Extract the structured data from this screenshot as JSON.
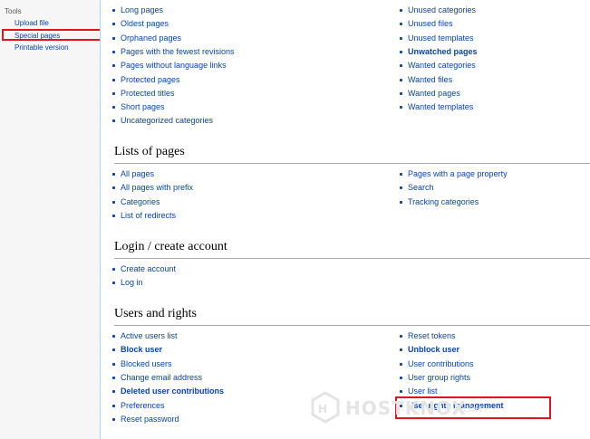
{
  "sidebar": {
    "heading": "Tools",
    "links": [
      "Upload file",
      "Special pages",
      "Printable version"
    ]
  },
  "top_lists": {
    "left": [
      {
        "label": "Long pages",
        "bold": false
      },
      {
        "label": "Oldest pages",
        "bold": false
      },
      {
        "label": "Orphaned pages",
        "bold": false
      },
      {
        "label": "Pages with the fewest revisions",
        "bold": false
      },
      {
        "label": "Pages without language links",
        "bold": false
      },
      {
        "label": "Protected pages",
        "bold": false
      },
      {
        "label": "Protected titles",
        "bold": false
      },
      {
        "label": "Short pages",
        "bold": false
      },
      {
        "label": "Uncategorized categories",
        "bold": false
      }
    ],
    "right": [
      {
        "label": "Unused categories",
        "bold": false
      },
      {
        "label": "Unused files",
        "bold": false
      },
      {
        "label": "Unused templates",
        "bold": false
      },
      {
        "label": "Unwatched pages",
        "bold": true
      },
      {
        "label": "Wanted categories",
        "bold": false
      },
      {
        "label": "Wanted files",
        "bold": false
      },
      {
        "label": "Wanted pages",
        "bold": false
      },
      {
        "label": "Wanted templates",
        "bold": false
      }
    ]
  },
  "sections": [
    {
      "title": "Lists of pages",
      "left": [
        {
          "label": "All pages",
          "bold": false
        },
        {
          "label": "All pages with prefix",
          "bold": false
        },
        {
          "label": "Categories",
          "bold": false
        },
        {
          "label": "List of redirects",
          "bold": false
        }
      ],
      "right": [
        {
          "label": "Pages with a page property",
          "bold": false
        },
        {
          "label": "Search",
          "bold": false
        },
        {
          "label": "Tracking categories",
          "bold": false
        }
      ]
    },
    {
      "title": "Login / create account",
      "left": [
        {
          "label": "Create account",
          "bold": false
        },
        {
          "label": "Log in",
          "bold": false
        }
      ],
      "right": []
    },
    {
      "title": "Users and rights",
      "left": [
        {
          "label": "Active users list",
          "bold": false
        },
        {
          "label": "Block user",
          "bold": true
        },
        {
          "label": "Blocked users",
          "bold": false
        },
        {
          "label": "Change email address",
          "bold": false
        },
        {
          "label": "Deleted user contributions",
          "bold": true
        },
        {
          "label": "Preferences",
          "bold": false
        },
        {
          "label": "Reset password",
          "bold": false
        }
      ],
      "right": [
        {
          "label": "Reset tokens",
          "bold": false
        },
        {
          "label": "Unblock user",
          "bold": true
        },
        {
          "label": "User contributions",
          "bold": false
        },
        {
          "label": "User group rights",
          "bold": false
        },
        {
          "label": "User list",
          "bold": false
        },
        {
          "label": "User rights management",
          "bold": true
        }
      ]
    }
  ],
  "watermark": {
    "text": "HOSTKNOX",
    "suffix": ".COM"
  },
  "colors": {
    "link": "#0645ad",
    "highlight": "#e0141c",
    "sidebar_bg": "#f6f6f6"
  }
}
